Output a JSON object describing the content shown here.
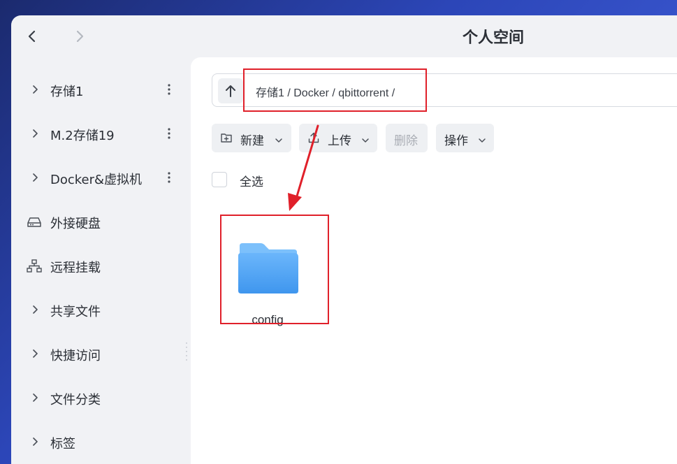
{
  "window": {
    "title": "个人空间"
  },
  "sidebar": {
    "items": [
      {
        "label": "存储1",
        "type": "expandable",
        "has_more": true,
        "icon": "chevron-right-icon"
      },
      {
        "label": "M.2存储19",
        "type": "expandable",
        "has_more": true,
        "icon": "chevron-right-icon"
      },
      {
        "label": "Docker&虚拟机",
        "type": "expandable",
        "has_more": true,
        "icon": "chevron-right-icon"
      },
      {
        "label": "外接硬盘",
        "type": "device",
        "has_more": false,
        "icon": "hard-drive-icon"
      },
      {
        "label": "远程挂载",
        "type": "device",
        "has_more": false,
        "icon": "network-icon"
      },
      {
        "label": "共享文件",
        "type": "expandable",
        "has_more": false,
        "icon": "chevron-right-icon"
      },
      {
        "label": "快捷访问",
        "type": "expandable",
        "has_more": false,
        "icon": "chevron-right-icon"
      },
      {
        "label": "文件分类",
        "type": "expandable",
        "has_more": false,
        "icon": "chevron-right-icon"
      },
      {
        "label": "标签",
        "type": "expandable",
        "has_more": false,
        "icon": "chevron-right-icon"
      }
    ]
  },
  "path_bar": {
    "path": "存储1 / Docker / qbittorrent /"
  },
  "toolbar": {
    "new_label": "新建",
    "upload_label": "上传",
    "delete_label": "删除",
    "actions_label": "操作"
  },
  "select_all": {
    "label": "全选"
  },
  "files": [
    {
      "name": "config",
      "type": "folder"
    }
  ],
  "colors": {
    "annotation": "#e0202a",
    "folder_front": "#4aa3f5",
    "folder_back": "#7cc0fb",
    "window_bg": "#f1f2f5",
    "content_bg": "#ffffff"
  }
}
